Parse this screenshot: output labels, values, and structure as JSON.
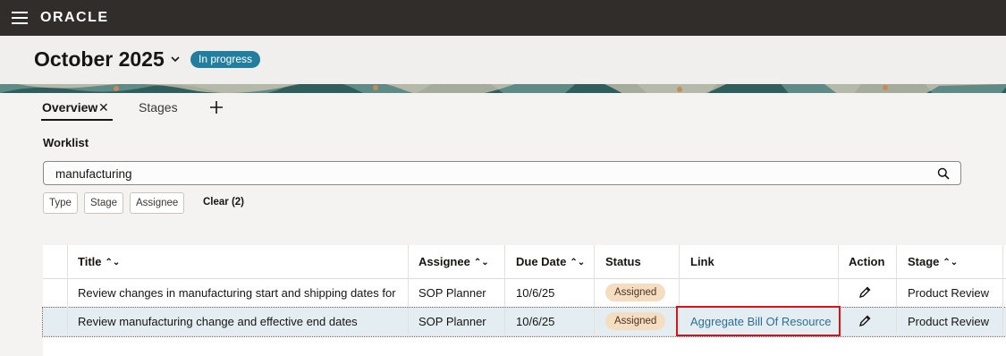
{
  "app": {
    "brand": "ORACLE"
  },
  "header": {
    "period": "October 2025",
    "status": "In progress",
    "status_color": "#227e9e"
  },
  "tabs": [
    {
      "label": "Overview",
      "active": true,
      "closable": true
    },
    {
      "label": "Stages",
      "active": false
    }
  ],
  "worklist": {
    "title": "Worklist",
    "search_value": "manufacturing",
    "filters": [
      "Type",
      "Stage",
      "Assignee"
    ],
    "clear_label": "Clear (2)"
  },
  "table": {
    "columns": [
      "Title",
      "Assignee",
      "Due Date",
      "Status",
      "Link",
      "Action",
      "Stage"
    ],
    "rows": [
      {
        "title": "Review changes in manufacturing start and shipping dates for",
        "assignee": "SOP Planner",
        "due_date": "10/6/25",
        "status": "Assigned",
        "link": "",
        "stage": "Product Review"
      },
      {
        "title": "Review manufacturing change and effective end dates",
        "assignee": "SOP Planner",
        "due_date": "10/6/25",
        "status": "Assigned",
        "link": "Aggregate Bill Of Resource",
        "stage": "Product Review"
      }
    ]
  },
  "colors": {
    "topbar": "#312d2a",
    "link": "#2c6f95",
    "selected_row": "#e4eef2",
    "highlight_box": "#d0161b",
    "badge": "#f5ddc2"
  },
  "icons": [
    "menu-icon",
    "chevron-down-icon",
    "close-icon",
    "plus-icon",
    "search-icon",
    "sort-icon",
    "pencil-icon"
  ]
}
